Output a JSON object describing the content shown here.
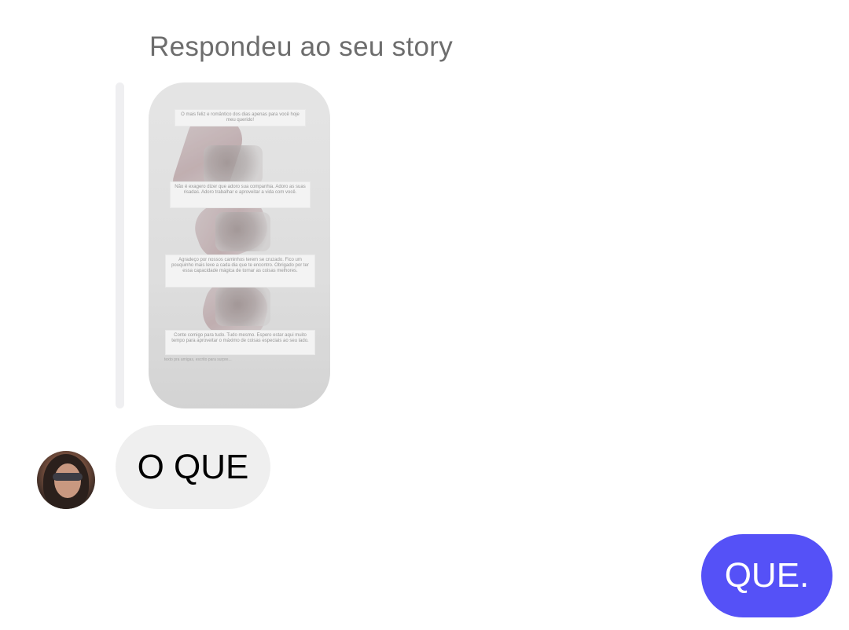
{
  "conversation": {
    "reply_label": "Respondeu ao seu story",
    "story": {
      "captions": [
        "O mais feliz e romântico dos dias apenas para você hoje meu querido!",
        "Não é exagero dizer que adoro sua companhia. Adoro as suas risadas. Adoro trabalhar e aproveitar a vida com você.",
        "Agradeço por nossos caminhos terem se cruzado. Fico um pouquinho mais leve a cada dia que te encontro. Obrigado por ter essa capacidade mágica de tornar as coisas melhores.",
        "Conte comigo para tudo. Tudo mesmo. Espero estar aqui muito tempo para aproveitar o máximo de coisas especiais ao seu lado."
      ],
      "footer_tag": "texto pra amigas, escrito para surpre..."
    },
    "messages": [
      {
        "direction": "incoming",
        "text": "O QUE"
      },
      {
        "direction": "outgoing",
        "text": "QUE."
      }
    ]
  },
  "colors": {
    "outgoing_bubble": "#5551f7",
    "incoming_bubble": "#efefef",
    "reply_label": "#6d6d6d"
  },
  "icons": {
    "avatar": "contact-avatar"
  }
}
